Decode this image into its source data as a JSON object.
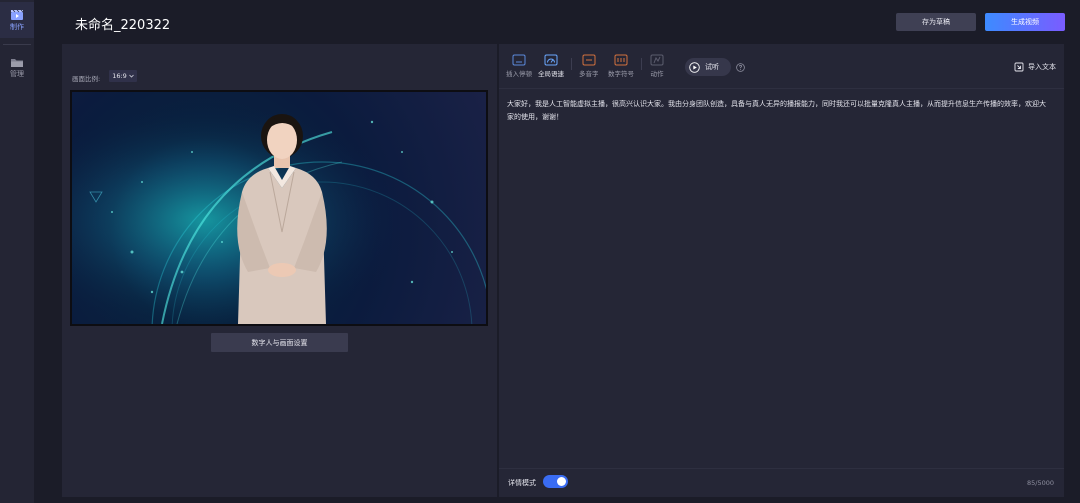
{
  "sidebar": {
    "items": [
      {
        "label": "制作",
        "icon": "video-clapper-icon",
        "active": true
      },
      {
        "label": "管理",
        "icon": "folder-icon",
        "active": false
      }
    ]
  },
  "header": {
    "title": "未命名_220322",
    "save_draft_label": "存为草稿",
    "generate_label": "生成视频"
  },
  "preview": {
    "ratio_label": "画面比例:",
    "ratio_value": "16:9",
    "settings_button": "数字人与画面设置"
  },
  "toolbar": {
    "items": [
      {
        "label": "插入停顿",
        "icon": "pause-insert-icon"
      },
      {
        "label": "全局语速",
        "icon": "speed-gauge-icon"
      },
      {
        "label": "多音字",
        "icon": "polyphone-icon"
      },
      {
        "label": "数字符号",
        "icon": "digit-symbol-icon"
      },
      {
        "label": "动作",
        "icon": "gesture-icon"
      }
    ],
    "listen_label": "试听",
    "import_label": "导入文本"
  },
  "editor": {
    "script_text": "大家好，我是人工智能虚拟主播，很高兴认识大家。我由分身团队创造，具备与真人无异的播报能力，同时我还可以批量克隆真人主播，从而提升信息生产传播的效率，欢迎大家的使用，谢谢！",
    "detail_mode_label": "详情模式",
    "detail_mode_on": true,
    "char_count": "85/5000"
  },
  "colors": {
    "background": "#1b1c28",
    "panel": "#252636",
    "accent_blue": "#3a6cf2",
    "gradient_start": "#3d8bff",
    "gradient_end": "#7a5cff"
  }
}
